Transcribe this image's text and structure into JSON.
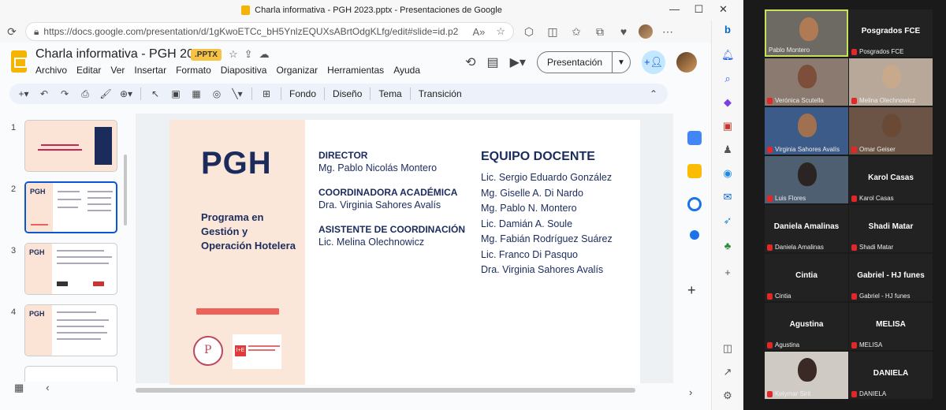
{
  "window": {
    "title": "Charla informativa - PGH 2023.pptx - Presentaciones de Google",
    "url": "https://docs.google.com/presentation/d/1gKwoETCc_bH5YnlzEQUXsABrtOdgKLfg/edit#slide=id.p2"
  },
  "doc": {
    "title": "Charla informativa - PGH 2023",
    "badge": ".PPTX",
    "menu": [
      "Archivo",
      "Editar",
      "Ver",
      "Insertar",
      "Formato",
      "Diapositiva",
      "Organizar",
      "Herramientas",
      "Ayuda"
    ],
    "present_label": "Presentación"
  },
  "toolbar": {
    "fondo": "Fondo",
    "diseno": "Diseño",
    "tema": "Tema",
    "transicion": "Transición"
  },
  "filmstrip": {
    "numbers": [
      "1",
      "2",
      "3",
      "4"
    ],
    "thumb_pgh": "PGH"
  },
  "slide": {
    "big": "PGH",
    "program": "Programa en Gestión y Operación Hotelera",
    "director_h": "DIRECTOR",
    "director": "Mg. Pablo Nicolás Montero",
    "coord_h": "COORDINADORA ACADÉMICA",
    "coord": "Dra. Virginia Sahores Avalís",
    "asist_h": "ASISTENTE DE COORDINACIÓN",
    "asist": "Lic. Melina Olechnowicz",
    "equipo_h": "EQUIPO DOCENTE",
    "equipo": [
      "Lic. Sergio Eduardo González",
      "Mg. Giselle A. Di Nardo",
      "Mg. Pablo N. Montero",
      "Lic. Damián A. Soule",
      "Mg. Fabián Rodríguez Suárez",
      "Lic. Franco Di Pasquo",
      "Dra. Virginia Sahores Avalís"
    ],
    "accent_red": "#ee6158",
    "navy": "#1b2c5c"
  },
  "gallery": {
    "tiles": [
      {
        "label": "Pablo Montero",
        "big": "",
        "video": true
      },
      {
        "label": "Posgrados FCE",
        "big": "Posgrados FCE",
        "video": false
      },
      {
        "label": "Verónica Scutella",
        "big": "",
        "video": true
      },
      {
        "label": "Melina Olechnowicz",
        "big": "",
        "video": true
      },
      {
        "label": "Virginia Sahores Avalís",
        "big": "",
        "video": true
      },
      {
        "label": "Omar Geiser",
        "big": "",
        "video": true
      },
      {
        "label": "Luis Flores",
        "big": "",
        "video": true
      },
      {
        "label": "Karol Casas",
        "big": "Karol Casas",
        "video": false
      },
      {
        "label": "Daniela Amalinas",
        "big": "Daniela Amalinas",
        "video": false
      },
      {
        "label": "Shadi Matar",
        "big": "Shadi Matar",
        "video": false
      },
      {
        "label": "Cintia",
        "big": "Cintia",
        "video": false
      },
      {
        "label": "Gabriel - HJ funes",
        "big": "Gabriel - HJ funes",
        "video": false
      },
      {
        "label": "Agustina",
        "big": "Agustina",
        "video": false
      },
      {
        "label": "MELISA",
        "big": "MELISA",
        "video": false
      },
      {
        "label": "Kelymar Sirit",
        "big": "",
        "video": true
      },
      {
        "label": "DANIELA",
        "big": "DANIELA",
        "video": false
      }
    ]
  }
}
